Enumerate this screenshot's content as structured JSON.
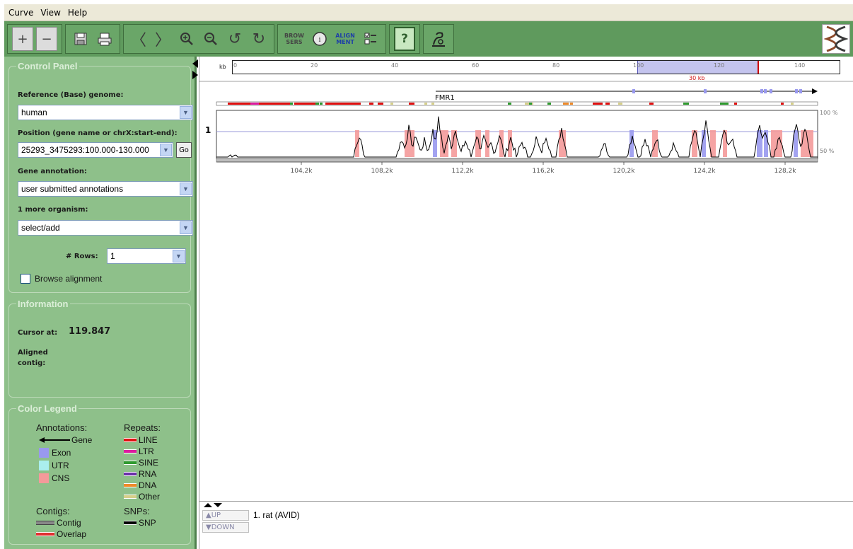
{
  "menu": {
    "items": [
      "Curve",
      "View",
      "Help"
    ]
  },
  "toolbar": {
    "browsers_label": "BROW\nSERS",
    "alignment_label": "ALIGN\nMENT",
    "help_label": "?"
  },
  "control_panel": {
    "title": "Control Panel",
    "reference_label": "Reference (Base) genome:",
    "reference_value": "human",
    "position_label": "Position (gene name or chrX:start-end):",
    "position_value": "25293_3475293:100.000-130.000",
    "go_label": "Go",
    "annotation_label": "Gene annotation:",
    "annotation_value": "user submitted annotations",
    "organism_label": "1 more organism:",
    "organism_value": "select/add",
    "rows_label": "# Rows:",
    "rows_value": "1",
    "browse_label": "Browse alignment"
  },
  "information": {
    "title": "Information",
    "cursor_label": "Cursor at:",
    "cursor_value": "119.847",
    "aligned_label": "Aligned\ncontig:"
  },
  "legend": {
    "title": "Color Legend",
    "annotations_head": "Annotations:",
    "repeats_head": "Repeats:",
    "contigs_head": "Contigs:",
    "snps_head": "SNPs:",
    "gene": "Gene",
    "exon": "Exon",
    "utr": "UTR",
    "cns": "CNS",
    "line": "LINE",
    "ltr": "LTR",
    "sine": "SINE",
    "rna": "RNA",
    "dna": "DNA",
    "other": "Other",
    "contig": "Contig",
    "overlap": "Overlap",
    "snp": "SNP"
  },
  "colors": {
    "panel_bg": "#8ec08a",
    "toolbar_bg": "#5f9a5d",
    "exon": "#9999ee",
    "utr": "#aaeeee",
    "cns": "#f49a9a",
    "line": "#e01010",
    "ltr": "#dd1ca0",
    "sine": "#2f9a2f",
    "rna": "#6a2fa8",
    "dna": "#ee8a2a",
    "other": "#d6cf8a"
  },
  "ruler": {
    "unit": "kb",
    "labels": [
      "0",
      "20",
      "40",
      "60",
      "80",
      "100",
      "120",
      "140"
    ],
    "window_label": "30 kb"
  },
  "track": {
    "row_label": "1",
    "gene_name": "FMR1",
    "pct_top": "100 %",
    "pct_bottom": "50 %",
    "x_labels": [
      "104,2k",
      "108,2k",
      "112,2k",
      "116,2k",
      "120,2k",
      "124,2k",
      "128,2k"
    ]
  },
  "bottom": {
    "up_label": "▲UP",
    "down_label": "▼DOWN",
    "organism_entry": "1. rat (AVID)"
  }
}
